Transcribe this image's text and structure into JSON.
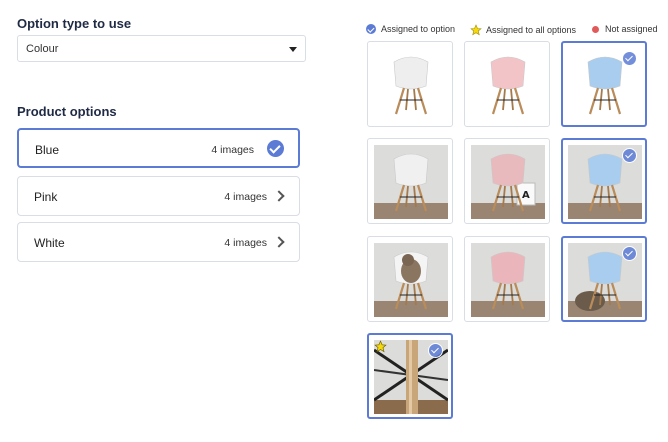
{
  "option_type": {
    "label": "Option type to use",
    "value": "Colour"
  },
  "product_options": {
    "label": "Product options",
    "items": [
      {
        "name": "Blue",
        "count": "4 images",
        "selected": true
      },
      {
        "name": "Pink",
        "count": "4 images",
        "selected": false
      },
      {
        "name": "White",
        "count": "4 images",
        "selected": false
      }
    ]
  },
  "legend": {
    "assigned": "Assigned to option",
    "assigned_all": "Assigned to all options",
    "not_assigned": "Not assigned"
  },
  "colors": {
    "accent": "#5b7bd5",
    "star": "#f5d90a",
    "not_assigned": "#e05a5a"
  },
  "images": [
    {
      "chair_color": "#eeeeee",
      "scene": "white-chair",
      "assigned": false
    },
    {
      "chair_color": "#f2c4c8",
      "scene": "pink-chair",
      "assigned": false
    },
    {
      "chair_color": "#a9cdee",
      "scene": "blue-chair",
      "assigned": true
    },
    {
      "chair_color": "#f0f0f0",
      "scene": "white-chair-room",
      "assigned": false
    },
    {
      "chair_color": "#e8b9bd",
      "scene": "pink-chair-room",
      "assigned": false
    },
    {
      "chair_color": "#a9cdee",
      "scene": "blue-chair-room",
      "assigned": true
    },
    {
      "chair_color": "#f4f4f4",
      "scene": "cat-on-chair",
      "assigned": false
    },
    {
      "chair_color": "#eab6bb",
      "scene": "pink-chair-closeup",
      "assigned": false
    },
    {
      "chair_color": "#a9cdee",
      "scene": "blue-chair-basket",
      "assigned": true
    },
    {
      "chair_color": "#c9a57a",
      "scene": "chair-legs-closeup",
      "assigned": true,
      "all_options": true
    }
  ]
}
